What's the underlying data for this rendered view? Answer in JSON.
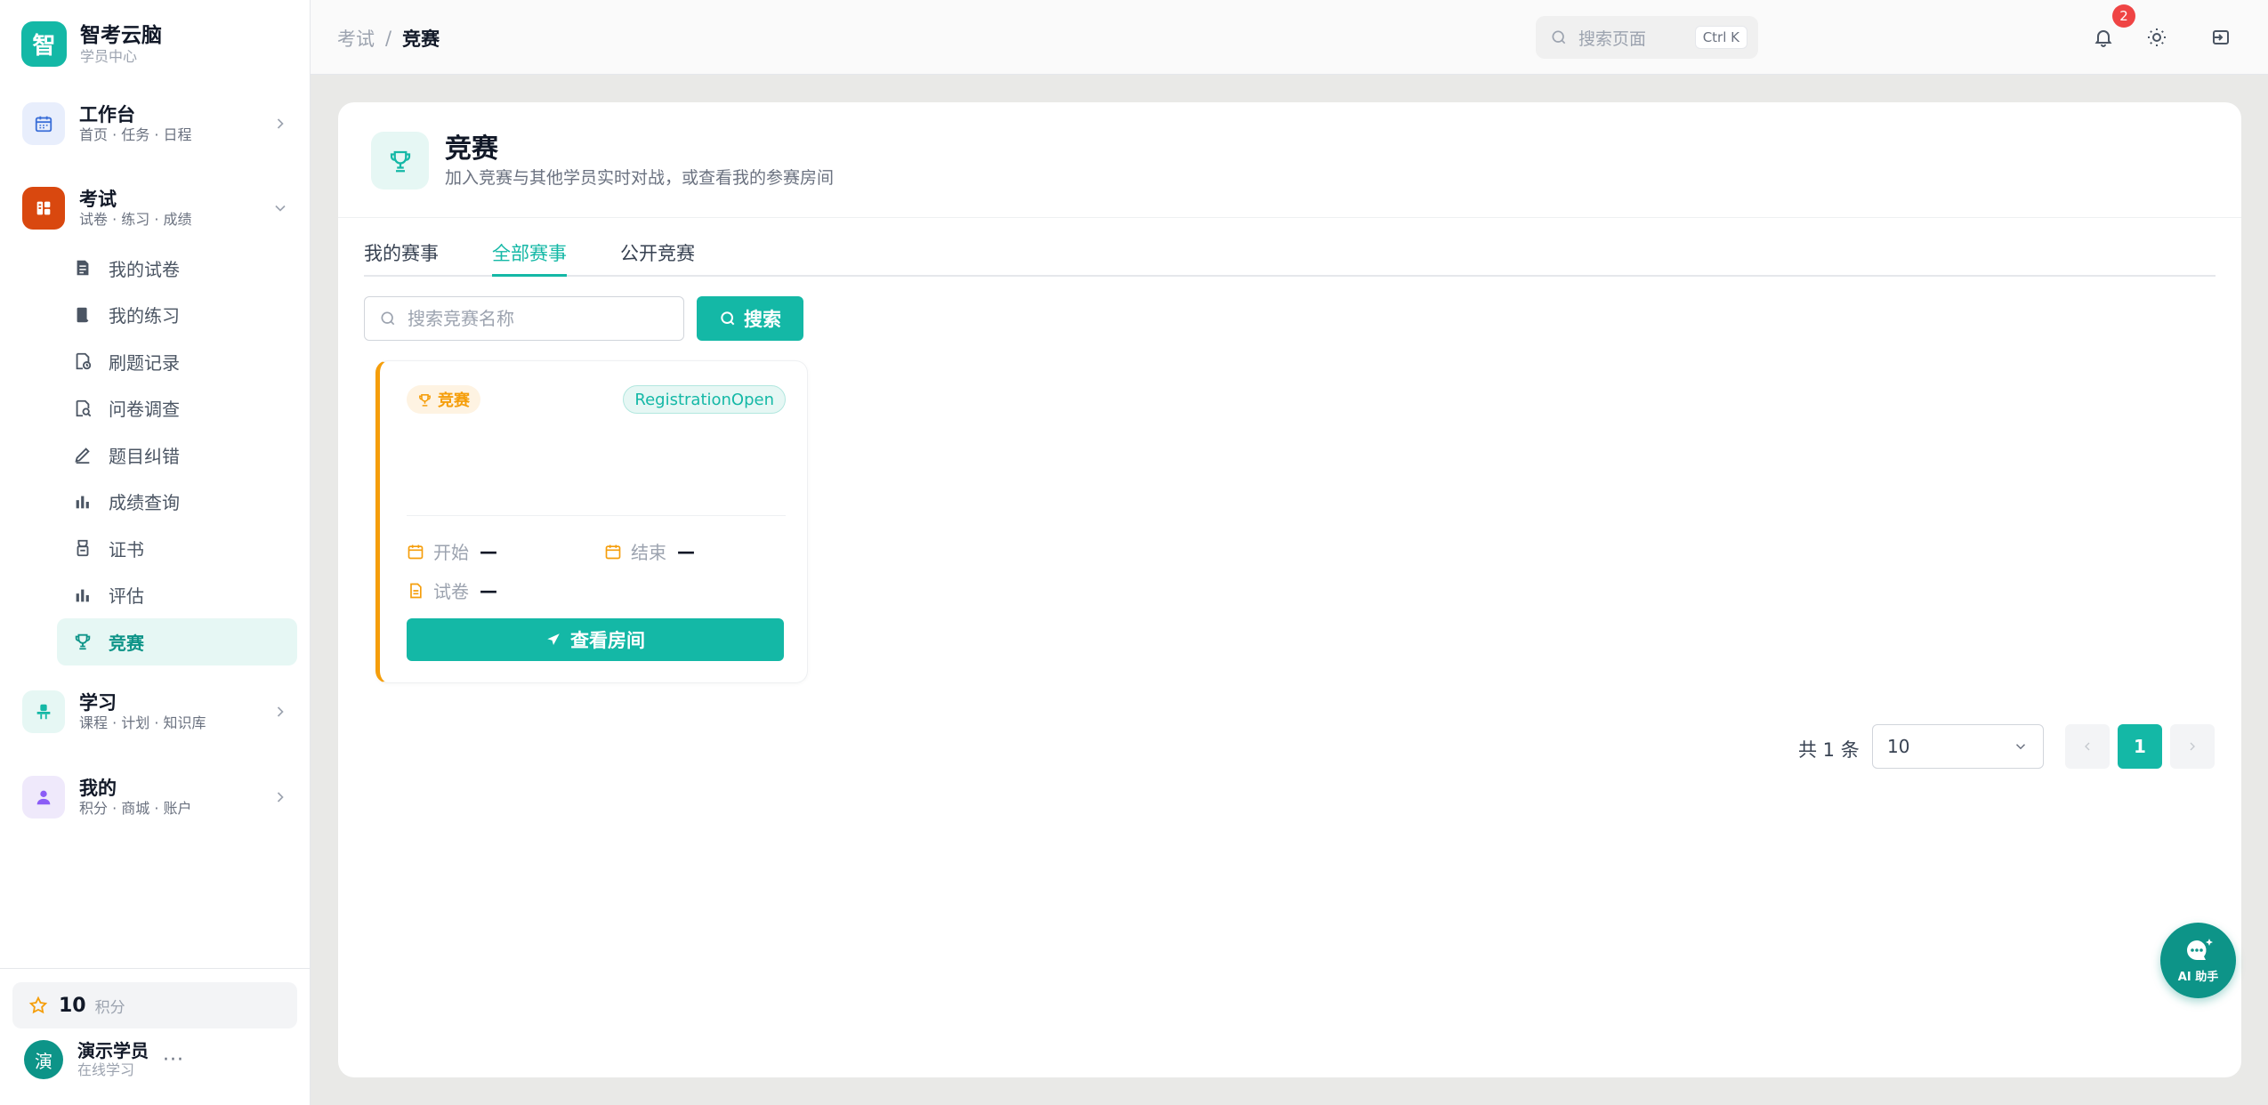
{
  "colors": {
    "primary": "#14b8a6",
    "primary_dark": "#0d9488",
    "accent_orange": "#f59e0b",
    "danger": "#ef4444",
    "active_bg": "#e6f7f4"
  },
  "brand": {
    "logo_char": "智",
    "name": "智考云脑",
    "subtitle": "学员中心"
  },
  "sidebar": {
    "groups": [
      {
        "title": "工作台",
        "subtitle": "首页 · 任务 · 日程",
        "icon": "calendar-icon",
        "expanded": false
      },
      {
        "title": "考试",
        "subtitle": "试卷 · 练习 · 成绩",
        "icon": "exam-icon",
        "expanded": true
      },
      {
        "title": "学习",
        "subtitle": "课程 · 计划 · 知识库",
        "icon": "study-icon",
        "expanded": false
      },
      {
        "title": "我的",
        "subtitle": "积分 · 商城 · 账户",
        "icon": "user-icon",
        "expanded": false
      }
    ],
    "exam_items": [
      {
        "label": "我的试卷",
        "icon": "paper-icon",
        "active": false
      },
      {
        "label": "我的练习",
        "icon": "practice-icon",
        "active": false
      },
      {
        "label": "刷题记录",
        "icon": "history-icon",
        "active": false
      },
      {
        "label": "问卷调查",
        "icon": "survey-icon",
        "active": false
      },
      {
        "label": "题目纠错",
        "icon": "edit-icon",
        "active": false
      },
      {
        "label": "成绩查询",
        "icon": "chart-icon",
        "active": false
      },
      {
        "label": "证书",
        "icon": "certificate-icon",
        "active": false
      },
      {
        "label": "评估",
        "icon": "assess-icon",
        "active": false
      },
      {
        "label": "竞赛",
        "icon": "trophy-icon",
        "active": true
      }
    ],
    "points": {
      "value": "10",
      "label": "积分"
    },
    "user": {
      "avatar_char": "演",
      "name": "演示学员",
      "status": "在线学习",
      "more": "···"
    }
  },
  "topbar": {
    "breadcrumb": {
      "parent": "考试",
      "separator": "/",
      "current": "竞赛"
    },
    "search_placeholder": "搜索页面",
    "shortcut": "Ctrl K",
    "notification_count": "2"
  },
  "page": {
    "title": "竞赛",
    "description": "加入竞赛与其他学员实时对战，或查看我的参赛房间",
    "tabs": [
      {
        "label": "我的赛事",
        "active": false
      },
      {
        "label": "全部赛事",
        "active": true
      },
      {
        "label": "公开竞赛",
        "active": false
      }
    ],
    "search_placeholder": "搜索竞赛名称",
    "search_button": "搜索"
  },
  "competitions": [
    {
      "tag": "竞赛",
      "status": "RegistrationOpen",
      "start_label": "开始",
      "start_value": "—",
      "end_label": "结束",
      "end_value": "—",
      "paper_label": "试卷",
      "paper_value": "—",
      "button": "查看房间"
    }
  ],
  "pagination": {
    "total_text": "共 1 条",
    "page_size": "10",
    "current_page": "1"
  },
  "ai_assistant": {
    "label": "AI 助手"
  }
}
